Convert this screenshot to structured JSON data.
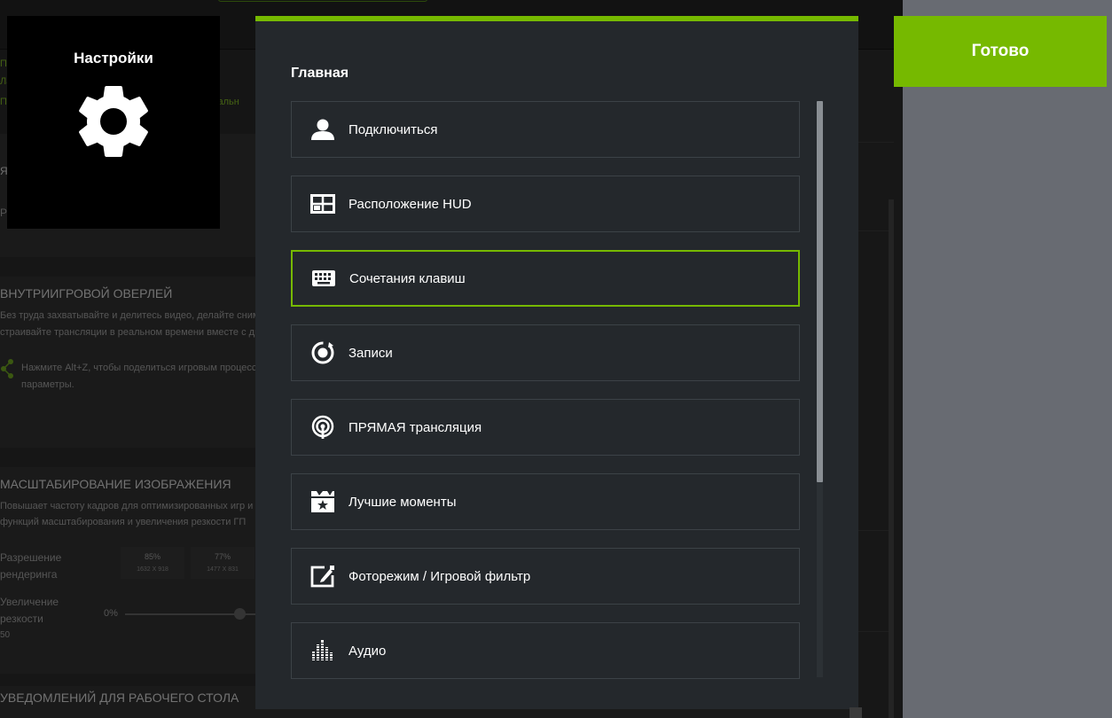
{
  "settings_tile": {
    "title": "Настройки",
    "icon": "gear-icon"
  },
  "dialog": {
    "section_title": "Главная",
    "items": [
      {
        "label": "Подключиться",
        "icon": "user-icon",
        "active": false
      },
      {
        "label": "Расположение HUD",
        "icon": "hud-layout-icon",
        "active": false
      },
      {
        "label": "Сочетания клавиш",
        "icon": "keyboard-icon",
        "active": true
      },
      {
        "label": "Записи",
        "icon": "recording-icon",
        "active": false
      },
      {
        "label": "ПРЯМАЯ трансляция",
        "icon": "broadcast-icon",
        "active": false
      },
      {
        "label": "Лучшие моменты",
        "icon": "highlights-icon",
        "active": false
      },
      {
        "label": "Фоторежим / Игровой фильтр",
        "icon": "photo-mode-icon",
        "active": false
      },
      {
        "label": "Аудио",
        "icon": "audio-icon",
        "active": false
      }
    ],
    "scroll_fraction_visible": 0.66
  },
  "done_button": {
    "label": "Готово"
  },
  "colors": {
    "accent": "#76b900",
    "dialog_bg": "#24282c",
    "side_panel": "#686b72"
  },
  "background": {
    "frag_la": "Ла",
    "frag_p": "П",
    "frag_social": "циальн",
    "frag_ya": "ЯЗ",
    "frag_ru": "Ру",
    "overlay_title": "ВНУТРИИГРОВОЙ ОВЕРЛЕЙ",
    "overlay_line1": "Без труда захватывайте и делитесь видео, делайте снимк",
    "overlay_line2": "страивайте трансляции в реальном времени вместе с др",
    "overlay_share1": "Нажмите Alt+Z, чтобы поделиться игровым процесс",
    "overlay_share2": "параметры.",
    "scaling_title": "МАСШТАБИРОВАНИЕ ИЗОБРАЖЕНИЯ",
    "scaling_line1": "Повышает частоту кадров для оптимизированных игр и пр",
    "scaling_line2": "функций масштабирования и увеличения резкости ГП",
    "render_label1": "Разрешение",
    "render_label2": "рендеринга",
    "scale1_pct": "85%",
    "scale1_res": "1632 X 918",
    "scale2_pct": "77%",
    "scale2_res": "1477 X 831",
    "sharp_label1": "Увеличение",
    "sharp_label2": "резкости",
    "sharp_value": "0%",
    "sharp_default": "50",
    "notifications_title": "УВЕДОМЛЕНИЙ ДЛЯ РАБОЧЕГО СТОЛА"
  }
}
